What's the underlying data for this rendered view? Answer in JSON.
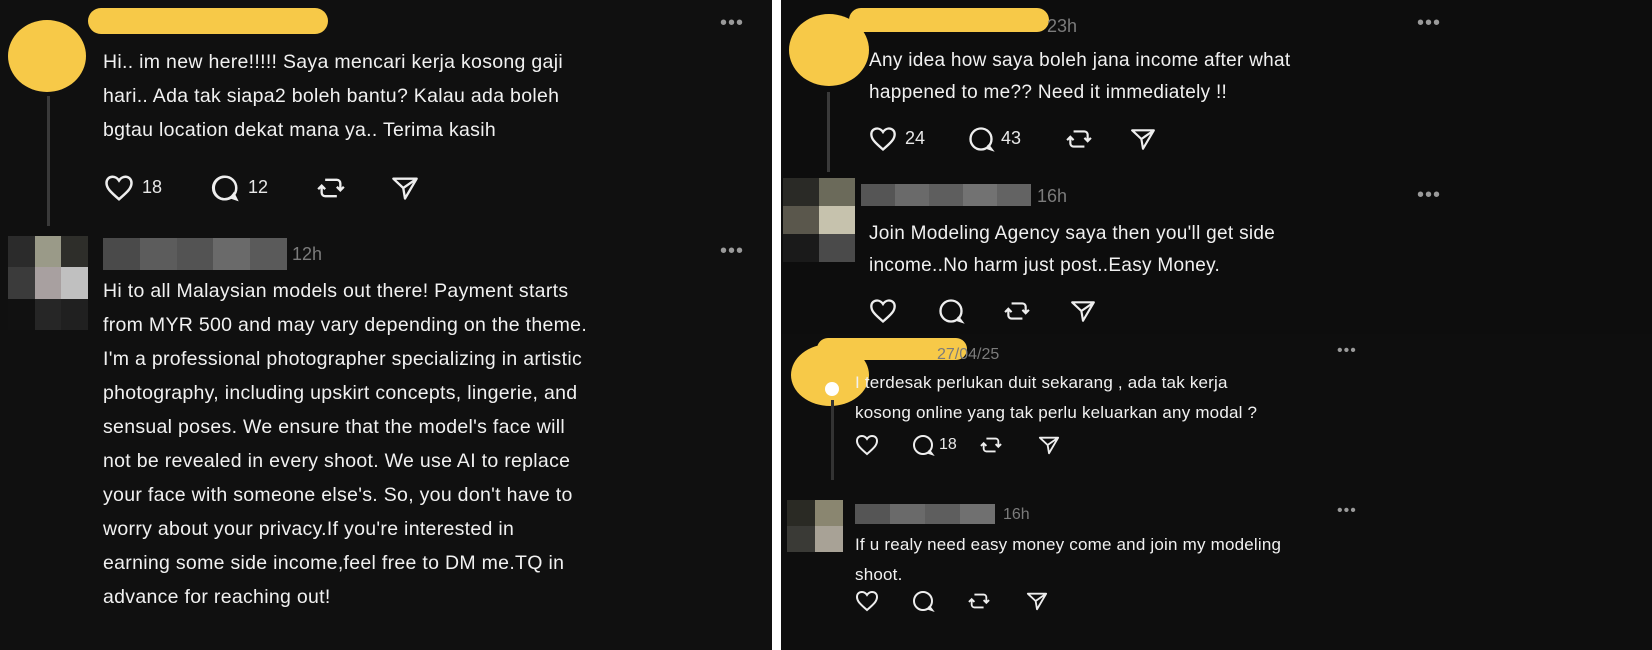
{
  "left": {
    "post": {
      "text_lines": [
        "Hi.. im new here!!!!! Saya mencari kerja kosong gaji",
        "hari.. Ada tak siapa2 boleh bantu? Kalau ada boleh",
        "bgtau location dekat mana ya.. Terima kasih"
      ],
      "likes": "18",
      "replies": "12"
    },
    "reply": {
      "time": "12h",
      "text_lines": [
        "Hi to all Malaysian models out there! Payment starts",
        "from MYR 500 and may vary depending on the theme.",
        "I'm a professional photographer specializing in artistic",
        "photography, including upskirt concepts, lingerie, and",
        "sensual poses. We ensure that the model's face will",
        "not be revealed in every shoot. We use AI to replace",
        "your face with someone else's. So, you don't have to",
        "worry about your privacy.If you're interested in",
        "earning some side income,feel free to DM me.TQ in",
        "advance for reaching out!"
      ]
    }
  },
  "right_top": {
    "post": {
      "time": "23h",
      "text_lines": [
        "Any idea how saya boleh jana income after what",
        "happened to me?? Need it immediately !!"
      ],
      "likes": "24",
      "replies": "43"
    },
    "reply": {
      "time": "16h",
      "text_lines": [
        "Join Modeling Agency saya then you'll get side",
        "income..No harm just post..Easy Money."
      ]
    }
  },
  "right_bottom": {
    "post": {
      "time": "27/04/25",
      "text_lines": [
        "I terdesak perlukan duit sekarang , ada tak kerja",
        "kosong online yang tak perlu keluarkan any modal ?"
      ],
      "replies": "18"
    },
    "reply": {
      "time": "16h",
      "text_lines": [
        "If u realy need easy money come and join my modeling",
        "shoot."
      ]
    }
  },
  "ui": {
    "more": "•••"
  },
  "colors": {
    "redaction": "#f7c948",
    "background": "#101010",
    "text": "#f1f1f1",
    "muted": "#7b7b7b"
  }
}
